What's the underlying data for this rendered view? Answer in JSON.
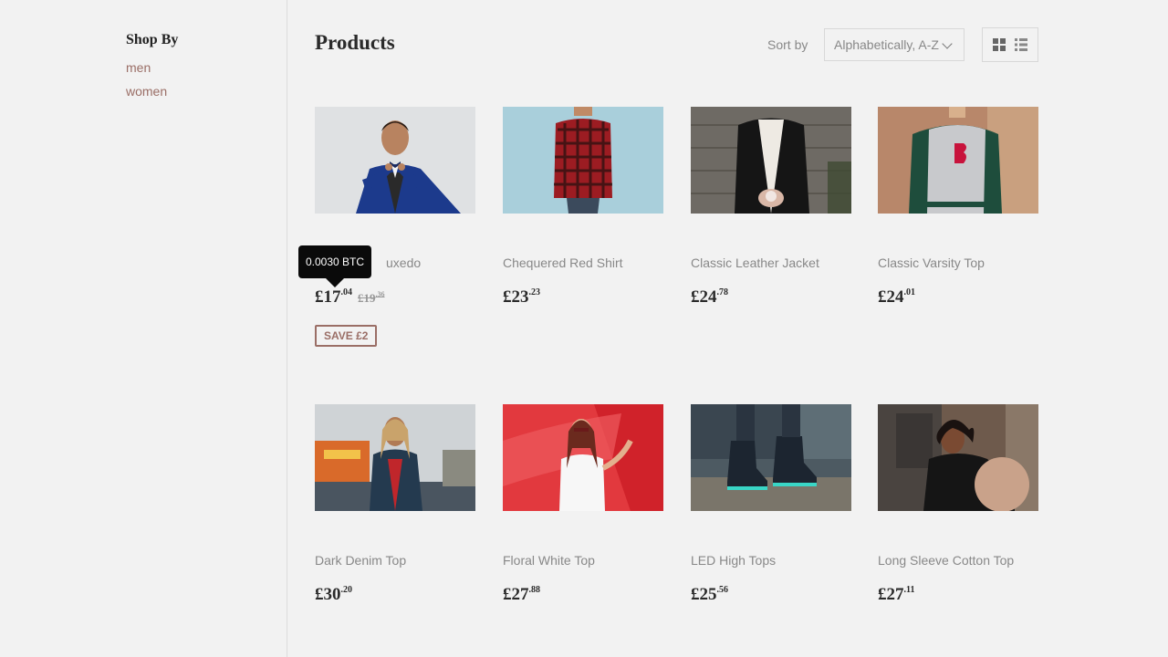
{
  "sidebar": {
    "title": "Shop By",
    "links": [
      {
        "label": "men"
      },
      {
        "label": "women"
      }
    ]
  },
  "header": {
    "title": "Products",
    "sort_label": "Sort by",
    "sort_value": "Alphabetically, A-Z",
    "view_grid_icon": "grid-view-icon",
    "view_list_icon": "list-view-icon"
  },
  "tooltip": {
    "text": "0.0030 BTC"
  },
  "products": [
    {
      "name": "Classic Tuxedo",
      "visible_name": "uxedo",
      "price_main": "£17",
      "price_cents": ".04",
      "old_main": "£19",
      "old_cents": ".36",
      "badge": "SAVE £2"
    },
    {
      "name": "Chequered Red Shirt",
      "price_main": "£23",
      "price_cents": ".23"
    },
    {
      "name": "Classic Leather Jacket",
      "price_main": "£24",
      "price_cents": ".78"
    },
    {
      "name": "Classic Varsity Top",
      "price_main": "£24",
      "price_cents": ".01"
    },
    {
      "name": "Dark Denim Top",
      "price_main": "£30",
      "price_cents": ".20"
    },
    {
      "name": "Floral White Top",
      "price_main": "£27",
      "price_cents": ".88"
    },
    {
      "name": "LED High Tops",
      "price_main": "£25",
      "price_cents": ".56"
    },
    {
      "name": "Long Sleeve Cotton Top",
      "price_main": "£27",
      "price_cents": ".11"
    }
  ],
  "colors": {
    "background": "#f2f2f2",
    "accent": "#9a6e66",
    "tooltip_bg": "#0a0a0a"
  }
}
